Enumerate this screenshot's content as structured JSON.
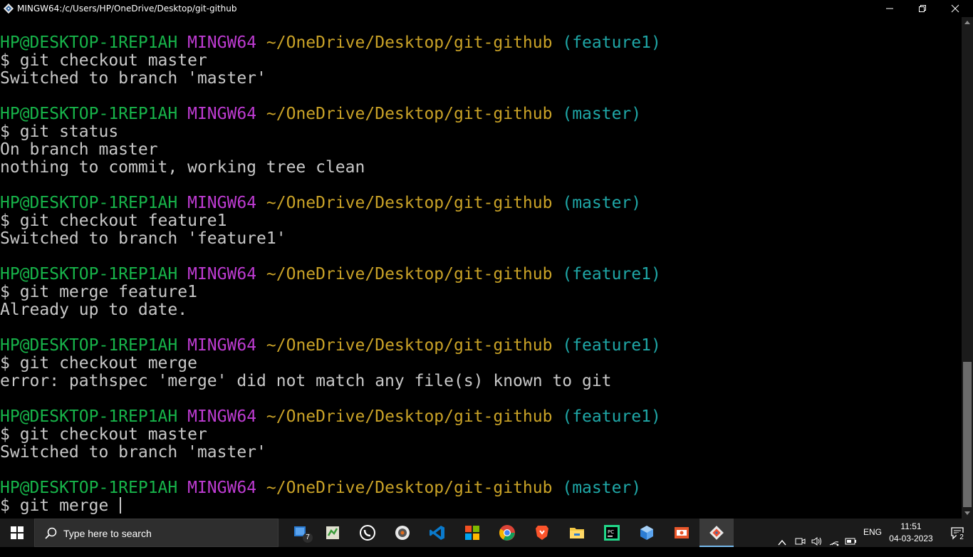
{
  "window": {
    "title": "MINGW64:/c/Users/HP/OneDrive/Desktop/git-github"
  },
  "terminal": {
    "blocks": [
      {
        "user": "HP@DESKTOP-1REP1AH",
        "sys": "MINGW64",
        "path": "~/OneDrive/Desktop/git-github",
        "branch": "(feature1)",
        "command": "$ git checkout master",
        "output": [
          "Switched to branch 'master'"
        ]
      },
      {
        "user": "HP@DESKTOP-1REP1AH",
        "sys": "MINGW64",
        "path": "~/OneDrive/Desktop/git-github",
        "branch": "(master)",
        "command": "$ git status",
        "output": [
          "On branch master",
          "nothing to commit, working tree clean"
        ]
      },
      {
        "user": "HP@DESKTOP-1REP1AH",
        "sys": "MINGW64",
        "path": "~/OneDrive/Desktop/git-github",
        "branch": "(master)",
        "command": "$ git checkout feature1",
        "output": [
          "Switched to branch 'feature1'"
        ]
      },
      {
        "user": "HP@DESKTOP-1REP1AH",
        "sys": "MINGW64",
        "path": "~/OneDrive/Desktop/git-github",
        "branch": "(feature1)",
        "command": "$ git merge feature1",
        "output": [
          "Already up to date."
        ]
      },
      {
        "user": "HP@DESKTOP-1REP1AH",
        "sys": "MINGW64",
        "path": "~/OneDrive/Desktop/git-github",
        "branch": "(feature1)",
        "command": "$ git checkout merge",
        "output": [
          "error: pathspec 'merge' did not match any file(s) known to git"
        ]
      },
      {
        "user": "HP@DESKTOP-1REP1AH",
        "sys": "MINGW64",
        "path": "~/OneDrive/Desktop/git-github",
        "branch": "(feature1)",
        "command": "$ git checkout master",
        "output": [
          "Switched to branch 'master'"
        ]
      },
      {
        "user": "HP@DESKTOP-1REP1AH",
        "sys": "MINGW64",
        "path": "~/OneDrive/Desktop/git-github",
        "branch": "(master)",
        "command": "$ git merge ",
        "output": []
      }
    ]
  },
  "taskbar": {
    "search_placeholder": "Type here to search",
    "language": "ENG",
    "time": "11:51",
    "date": "04-03-2023",
    "notification_count": "2",
    "task_view_badge": "7"
  },
  "colors": {
    "user": "#17b44a",
    "sys": "#bd3bd1",
    "path": "#c9a227",
    "branch": "#1fa7a7"
  }
}
